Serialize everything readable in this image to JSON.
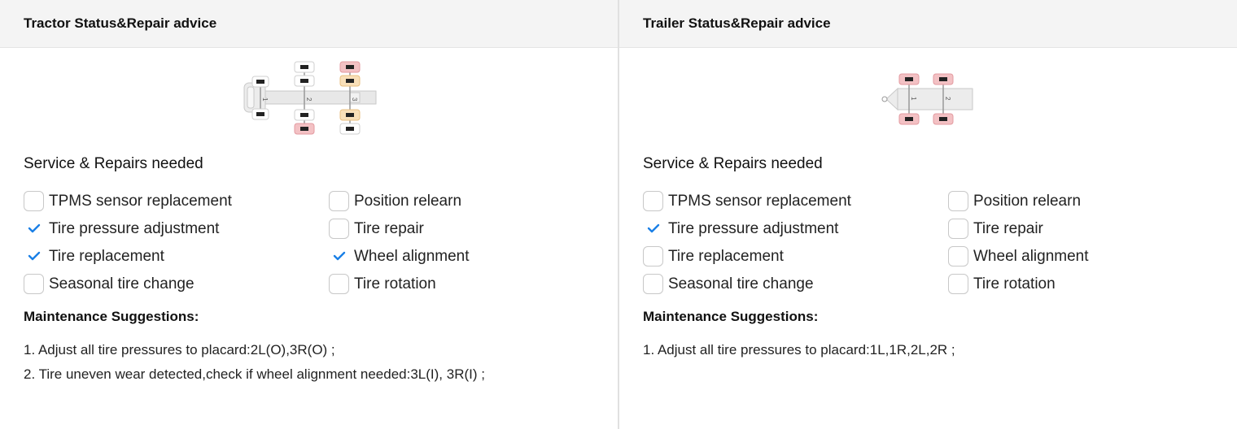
{
  "tractor": {
    "title": "Tractor Status&Repair advice",
    "service_title": "Service & Repairs needed",
    "checks": [
      {
        "label": "TPMS sensor replacement",
        "checked": false
      },
      {
        "label": "Position relearn",
        "checked": false
      },
      {
        "label": "Tire pressure adjustment",
        "checked": true
      },
      {
        "label": "Tire repair",
        "checked": false
      },
      {
        "label": "Tire replacement",
        "checked": true
      },
      {
        "label": "Wheel alignment",
        "checked": true
      },
      {
        "label": "Seasonal tire change",
        "checked": false
      },
      {
        "label": "Tire rotation",
        "checked": false
      }
    ],
    "maintenance_title": "Maintenance Suggestions:",
    "suggestions": [
      "1. Adjust all tire pressures to placard:2L(O),3R(O) ;",
      "2. Tire uneven wear detected,check if wheel alignment needed:3L(I), 3R(I) ;"
    ],
    "axle_labels": [
      "1",
      "2",
      "3"
    ]
  },
  "trailer": {
    "title": "Trailer Status&Repair advice",
    "service_title": "Service & Repairs needed",
    "checks": [
      {
        "label": "TPMS sensor replacement",
        "checked": false
      },
      {
        "label": "Position relearn",
        "checked": false
      },
      {
        "label": "Tire pressure adjustment",
        "checked": true
      },
      {
        "label": "Tire repair",
        "checked": false
      },
      {
        "label": "Tire replacement",
        "checked": false
      },
      {
        "label": "Wheel alignment",
        "checked": false
      },
      {
        "label": "Seasonal tire change",
        "checked": false
      },
      {
        "label": "Tire rotation",
        "checked": false
      }
    ],
    "maintenance_title": "Maintenance Suggestions:",
    "suggestions": [
      "1. Adjust all tire pressures to placard:1L,1R,2L,2R ;"
    ],
    "axle_labels": [
      "1",
      "2"
    ]
  },
  "colors": {
    "check": "#1a7fe6",
    "tire_alert": "#f3c1c4",
    "tire_warn": "#f8dfb8",
    "tire_normal": "#ffffff"
  }
}
